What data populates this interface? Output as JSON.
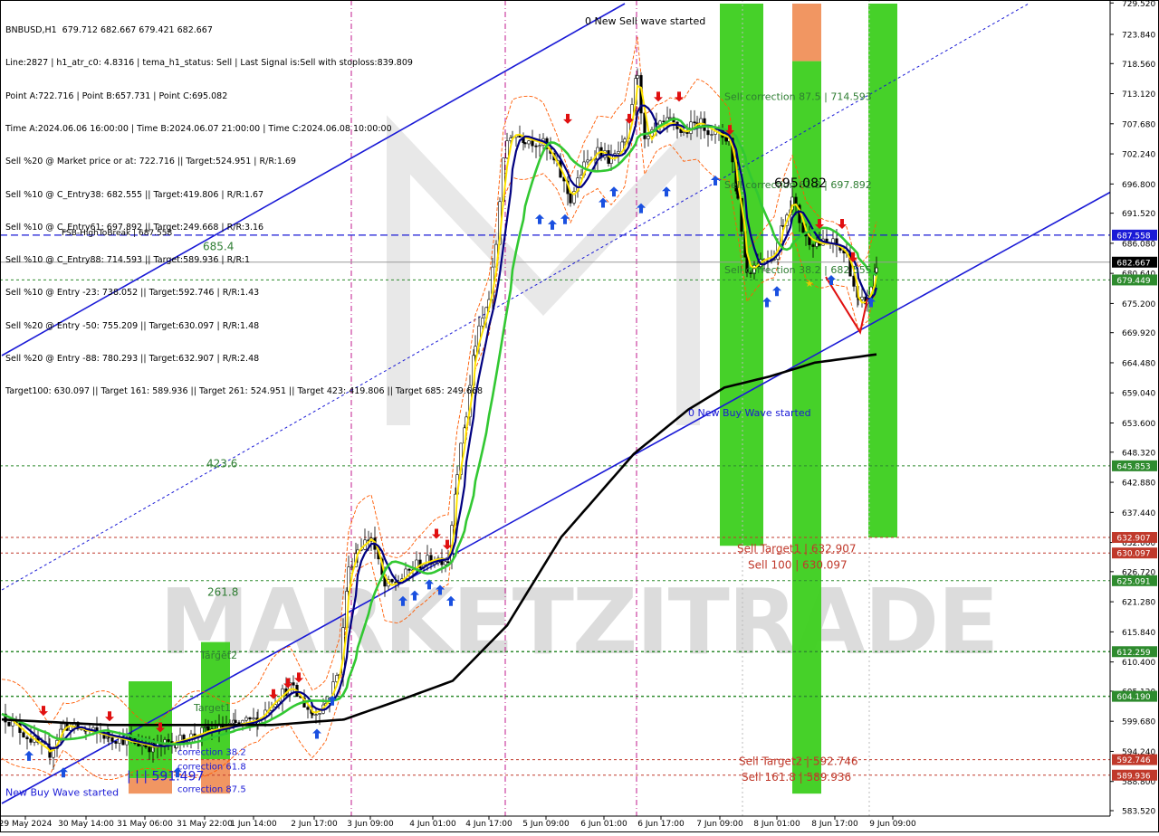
{
  "header": {
    "lines": [
      "BNBUSD,H1  679.712 682.667 679.421 682.667",
      "Line:2827 | h1_atr_c0: 4.8316 | tema_h1_status: Sell | Last Signal is:Sell with stoploss:839.809",
      "Point A:722.716 | Point B:657.731 | Point C:695.082",
      "Time A:2024.06.06 16:00:00 | Time B:2024.06.07 21:00:00 | Time C:2024.06.08 10:00:00",
      "Sell %20 @ Market price or at: 722.716 || Target:524.951 | R/R:1.69",
      "Sell %10 @ C_Entry38: 682.555 || Target:419.806 | R/R:1.67",
      "Sell %10 @ C_Entry61: 697.892 || Target:249.668 | R/R:3.16",
      "Sell %10 @ C_Entry88: 714.593 || Target:589.936 | R/R:1",
      "Sell %10 @ Entry -23: 738.052 || Target:592.746 | R/R:1.43",
      "Sell %20 @ Entry -50: 755.209 || Target:630.097 | R/R:1.48",
      "Sell %20 @ Entry -88: 780.293 || Target:632.907 | R/R:2.48",
      "Target100: 630.097 || Target 161: 589.936 || Target 261: 524.951 || Target 423: 419.806 || Target 685: 249.668"
    ]
  },
  "chart_data": {
    "type": "candlestick",
    "symbol": "BNBUSD",
    "timeframe": "H1",
    "ohlc": {
      "open": 679.712,
      "high": 682.667,
      "low": 679.421,
      "close": 682.667
    },
    "y_axis": {
      "range": [
        583.52,
        729.4
      ],
      "ticks": [
        "729.520",
        "723.840",
        "718.560",
        "713.120",
        "707.680",
        "702.240",
        "696.800",
        "691.520",
        "686.080",
        "680.640",
        "675.200",
        "669.920",
        "664.480",
        "659.040",
        "653.600",
        "648.320",
        "642.880",
        "637.440",
        "632.000",
        "626.720",
        "621.280",
        "615.840",
        "610.400",
        "605.120",
        "599.680",
        "594.240",
        "588.800",
        "583.520"
      ]
    },
    "x_axis": {
      "ticks": [
        "29 May 2024",
        "30 May 14:00",
        "31 May 06:00",
        "31 May 22:00",
        "1 Jun 14:00",
        "2 Jun 17:00",
        "3 Jun 09:00",
        "4 Jun 01:00",
        "4 Jun 17:00",
        "5 Jun 09:00",
        "6 Jun 01:00",
        "6 Jun 17:00",
        "7 Jun 09:00",
        "8 Jun 01:00",
        "8 Jun 17:00",
        "9 Jun 09:00"
      ]
    },
    "price_tags": [
      {
        "value": 687.558,
        "label": "687.558",
        "color": "#1a1ad6"
      },
      {
        "value": 682.667,
        "label": "682.667",
        "color": "#000000"
      },
      {
        "value": 679.449,
        "label": "679.449",
        "color": "#2e8b2e"
      },
      {
        "value": 645.853,
        "label": "645.853",
        "color": "#2e8b2e"
      },
      {
        "value": 632.907,
        "label": "632.907",
        "color": "#c0392b"
      },
      {
        "value": 630.097,
        "label": "630.097",
        "color": "#c0392b"
      },
      {
        "value": 625.091,
        "label": "625.091",
        "color": "#2e8b2e"
      },
      {
        "value": 612.259,
        "label": "612.259",
        "color": "#2e8b2e"
      },
      {
        "value": 604.19,
        "label": "604.190",
        "color": "#2e8b2e"
      },
      {
        "value": 592.746,
        "label": "592.746",
        "color": "#c0392b"
      },
      {
        "value": 589.936,
        "label": "589.936",
        "color": "#c0392b"
      }
    ],
    "annotations": [
      {
        "text": "FSB-HighToBreak | 687.558",
        "color": "#000000"
      },
      {
        "text": "685.4",
        "color": "#2e7d32"
      },
      {
        "text": "423.6",
        "color": "#2e7d32"
      },
      {
        "text": "261.8",
        "color": "#2e7d32"
      },
      {
        "text": "Target2",
        "color": "#2e7d32"
      },
      {
        "text": "Target1",
        "color": "#2e7d32"
      },
      {
        "text": "0 New Sell wave started",
        "color": "#000000"
      },
      {
        "text": "0 New Buy Wave started",
        "color": "#1a1ad6"
      },
      {
        "text": "New Buy Wave started",
        "color": "#1a1ad6"
      },
      {
        "text": "Sell correction 87.5 | 714.593",
        "color": "#2e7d32"
      },
      {
        "text": "Sell correction 61.8 | 697.892",
        "color": "#2e7d32"
      },
      {
        "text": "Sell correction 38.2 | 682.555",
        "color": "#2e7d32"
      },
      {
        "text": "695.082",
        "color": "#000000"
      },
      {
        "text": "Sell Target1 | 632.907",
        "color": "#c0392b"
      },
      {
        "text": "Sell 100 | 630.097",
        "color": "#c0392b"
      },
      {
        "text": "Sell Target2 | 592.746",
        "color": "#c0392b"
      },
      {
        "text": "Sell 161.8 | 589.936",
        "color": "#c0392b"
      },
      {
        "text": "correction 38.2",
        "color": "#1a1ad6"
      },
      {
        "text": "correction 61.8",
        "color": "#1a1ad6"
      },
      {
        "text": "correction 87.5",
        "color": "#1a1ad6"
      },
      {
        "text": "| | | 591.497",
        "color": "#1a1ad6"
      }
    ],
    "watermark": "MARKETZITRADE",
    "colors": {
      "candle": "#000000",
      "ma_fast": "#ffe600",
      "ma_mid": "#000080",
      "ma_slow": "#32c832",
      "ma_long": "#000000",
      "channel": "#1a1ad6",
      "bar_green": "#3ccf1e",
      "bar_orange": "#f0905a",
      "sell_arrow": "#e01010",
      "buy_arrow": "#1a50e0"
    }
  }
}
